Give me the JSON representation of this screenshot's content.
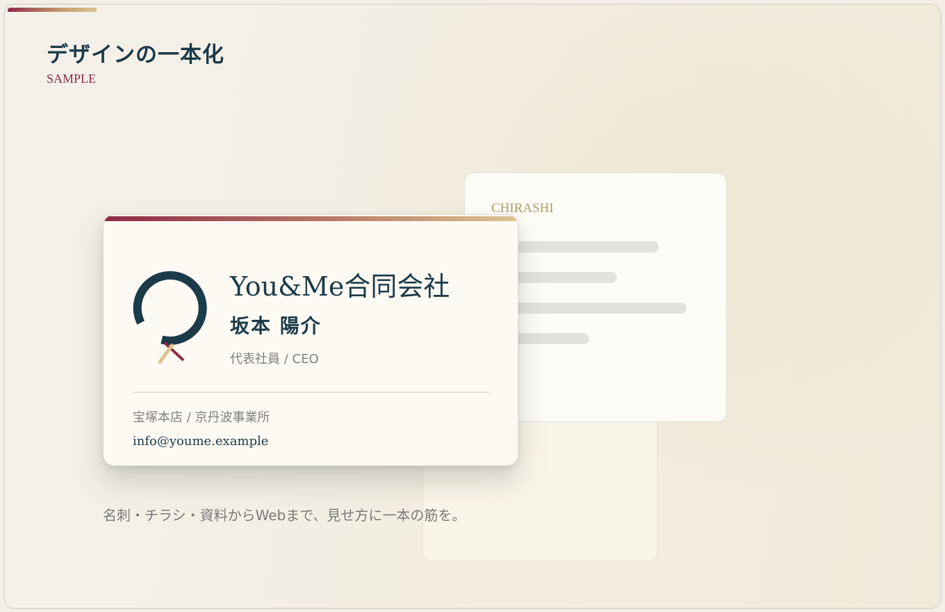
{
  "header": {
    "title": "デザインの一本化",
    "subtitle": "SAMPLE"
  },
  "business_card": {
    "company": "You&Me合同会社",
    "person_name": "坂本 陽介",
    "role": "代表社員 / CEO",
    "offices": "宝塚本店 / 京丹波事業所",
    "email": "info@youme.example",
    "logo_icon": "q-ring-logo-icon"
  },
  "flyer_card": {
    "label": "CHIRASHI"
  },
  "tagline": "名刺・チラシ・資料からWebまで、見せ方に一本の筋を。",
  "colors": {
    "navy": "#1b3a4a",
    "wine": "#8e2a45",
    "gold": "#dcc38f",
    "background": "#f3efe6"
  }
}
